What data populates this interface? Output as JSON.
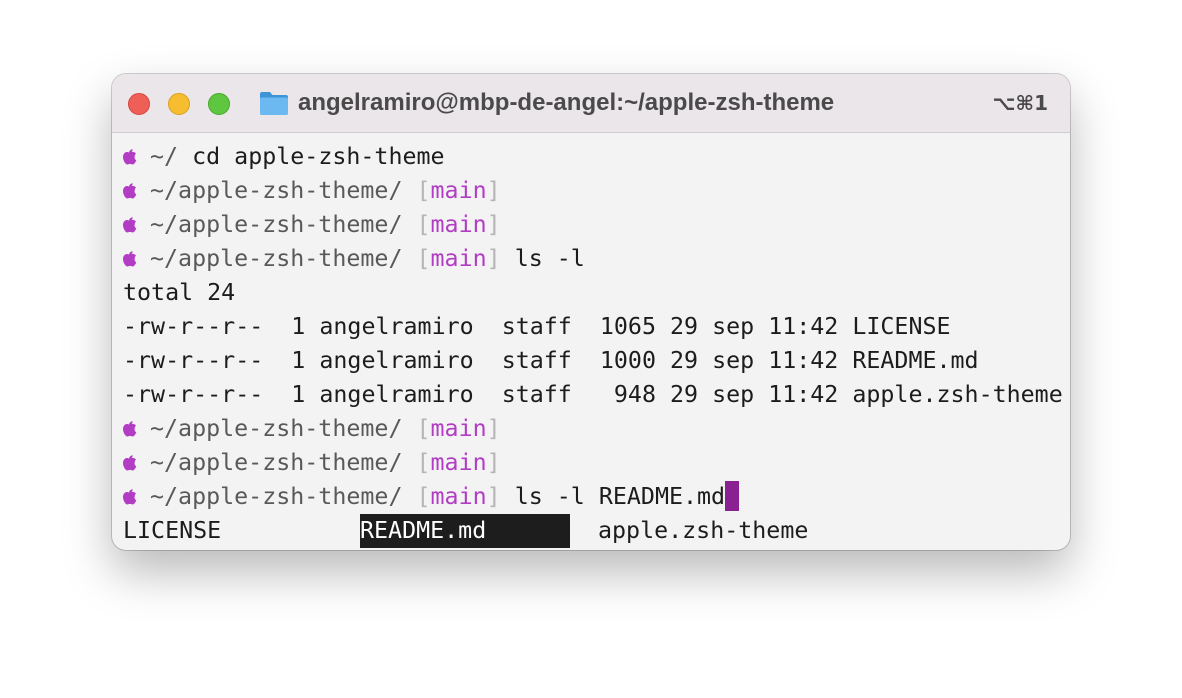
{
  "window": {
    "title": "angelramiro@mbp-de-angel:~/apple-zsh-theme",
    "shortcut": "⌥⌘1"
  },
  "colors": {
    "accent_branch": "#b23dc4",
    "cursor": "#8a2193",
    "selection_bg": "#1d1d1d"
  },
  "icons": {
    "prompt": "apple-icon",
    "title": "folder-icon"
  },
  "terminal": {
    "prompts": [
      {
        "path": "~/",
        "bracket_open": "",
        "branch": "",
        "bracket_close": "",
        "command": " cd apple-zsh-theme"
      },
      {
        "path": "~/apple-zsh-theme/",
        "bracket_open": "[",
        "branch": "main",
        "bracket_close": "]",
        "command": ""
      },
      {
        "path": "~/apple-zsh-theme/",
        "bracket_open": "[",
        "branch": "main",
        "bracket_close": "]",
        "command": ""
      },
      {
        "path": "~/apple-zsh-theme/",
        "bracket_open": "[",
        "branch": "main",
        "bracket_close": "]",
        "command": " ls -l"
      }
    ],
    "output": [
      "total 24",
      "-rw-r--r--  1 angelramiro  staff  1065 29 sep 11:42 LICENSE",
      "-rw-r--r--  1 angelramiro  staff  1000 29 sep 11:42 README.md",
      "-rw-r--r--  1 angelramiro  staff   948 29 sep 11:42 apple.zsh-theme"
    ],
    "prompts2": [
      {
        "path": "~/apple-zsh-theme/",
        "bracket_open": "[",
        "branch": "main",
        "bracket_close": "]",
        "command": ""
      },
      {
        "path": "~/apple-zsh-theme/",
        "bracket_open": "[",
        "branch": "main",
        "bracket_close": "]",
        "command": ""
      },
      {
        "path": "~/apple-zsh-theme/",
        "bracket_open": "[",
        "branch": "main",
        "bracket_close": "]",
        "command": " ls -l README.md"
      }
    ],
    "completions": [
      "LICENSE",
      "README.md",
      "apple.zsh-theme"
    ]
  }
}
